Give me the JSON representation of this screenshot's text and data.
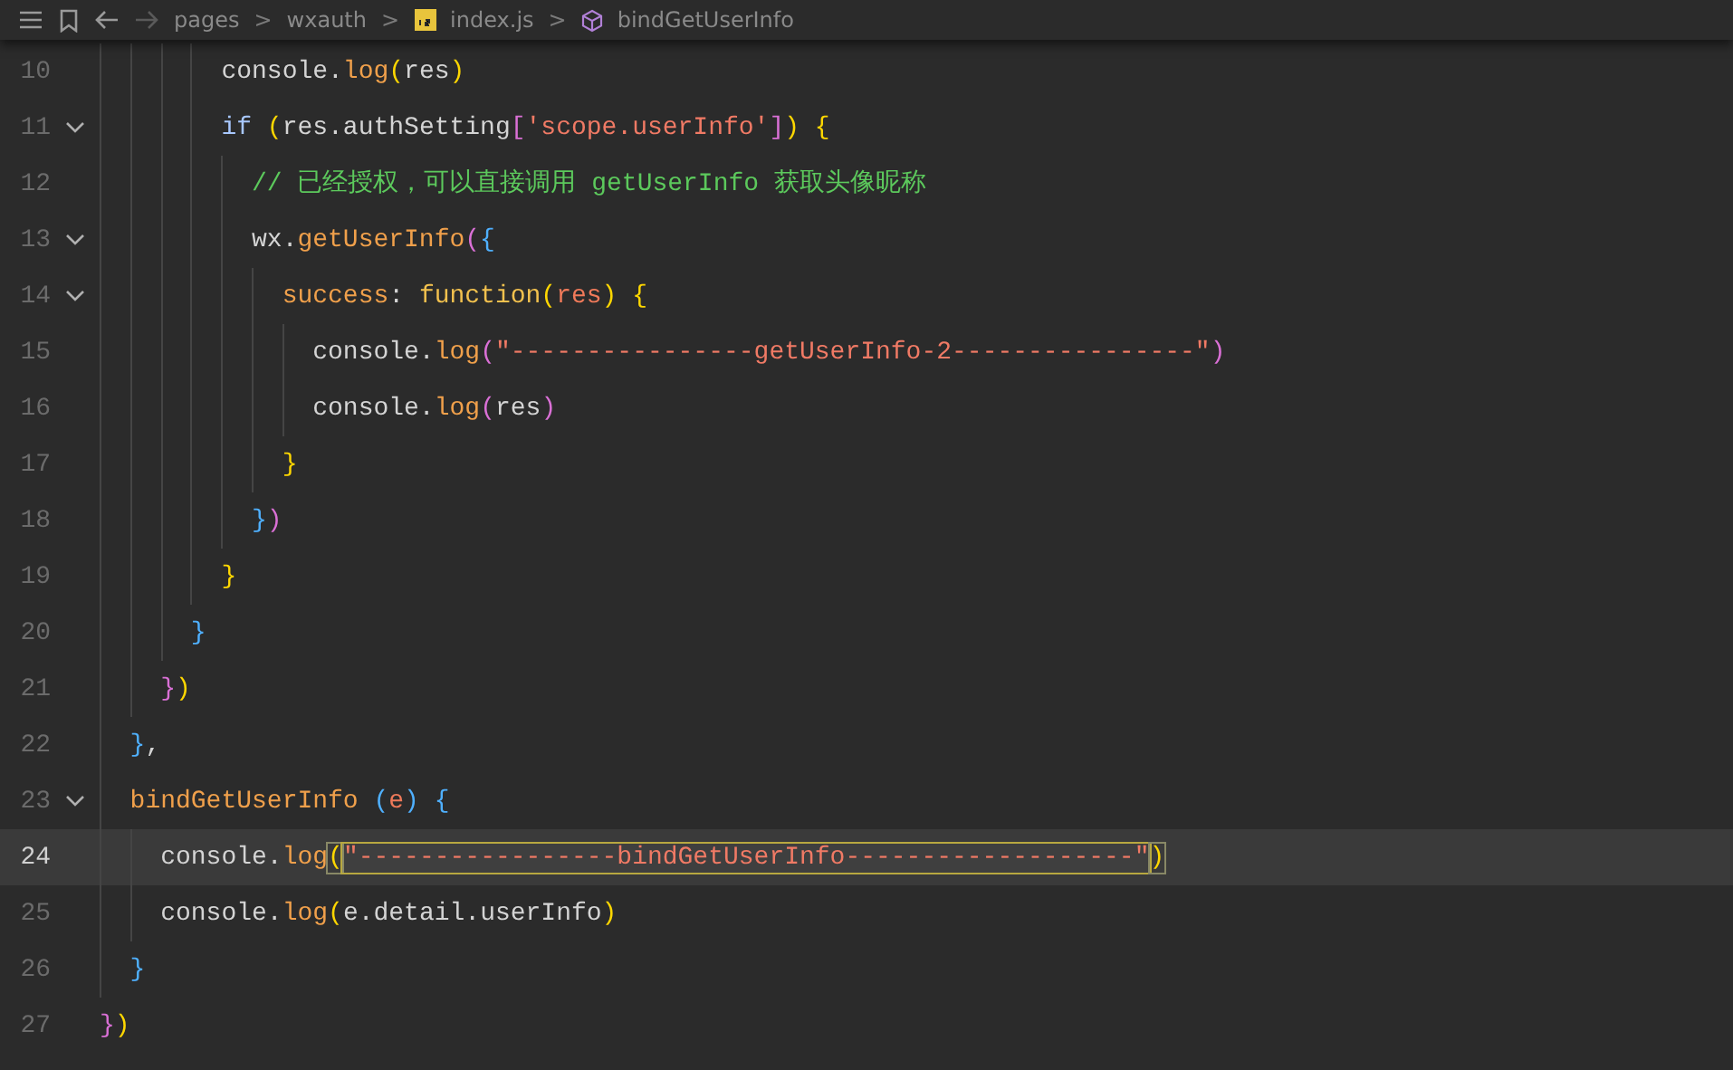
{
  "breadcrumb": {
    "items": [
      {
        "kind": "folder",
        "text": "pages"
      },
      {
        "kind": "folder",
        "text": "wxauth"
      },
      {
        "kind": "file",
        "text": "index.js"
      },
      {
        "kind": "symbol",
        "text": "bindGetUserInfo"
      }
    ],
    "separator": ">"
  },
  "lines": [
    {
      "number": "10",
      "foldable": false,
      "current": false,
      "tokens": [
        {
          "kind": "plain",
          "text": "        console."
        },
        {
          "kind": "method",
          "text": "log"
        },
        {
          "kind": "bracket-y",
          "text": "("
        },
        {
          "kind": "plain",
          "text": "res"
        },
        {
          "kind": "bracket-y",
          "text": ")"
        }
      ]
    },
    {
      "number": "11",
      "foldable": true,
      "current": false,
      "tokens": [
        {
          "kind": "control",
          "text": "        if "
        },
        {
          "kind": "bracket-y",
          "text": "("
        },
        {
          "kind": "plain",
          "text": "res.authSetting"
        },
        {
          "kind": "bracket-p",
          "text": "["
        },
        {
          "kind": "string",
          "text": "'scope.userInfo'"
        },
        {
          "kind": "bracket-p",
          "text": "]"
        },
        {
          "kind": "bracket-y",
          "text": ") {"
        }
      ]
    },
    {
      "number": "12",
      "foldable": false,
      "current": false,
      "tokens": [
        {
          "kind": "comment",
          "text": "          // 已经授权，可以直接调用 getUserInfo 获取头像昵称"
        }
      ]
    },
    {
      "number": "13",
      "foldable": true,
      "current": false,
      "tokens": [
        {
          "kind": "plain",
          "text": "          wx."
        },
        {
          "kind": "method",
          "text": "getUserInfo"
        },
        {
          "kind": "bracket-p",
          "text": "("
        },
        {
          "kind": "bracket-b",
          "text": "{"
        }
      ]
    },
    {
      "number": "14",
      "foldable": true,
      "current": false,
      "tokens": [
        {
          "kind": "property",
          "text": "            success"
        },
        {
          "kind": "plain",
          "text": ": "
        },
        {
          "kind": "keyword",
          "text": "function"
        },
        {
          "kind": "bracket-y",
          "text": "("
        },
        {
          "kind": "param",
          "text": "res"
        },
        {
          "kind": "bracket-y",
          "text": ") {"
        }
      ]
    },
    {
      "number": "15",
      "foldable": false,
      "current": false,
      "tokens": [
        {
          "kind": "plain",
          "text": "              console."
        },
        {
          "kind": "method",
          "text": "log"
        },
        {
          "kind": "bracket-p",
          "text": "("
        },
        {
          "kind": "string",
          "text": "\"----------------getUserInfo-2----------------\""
        },
        {
          "kind": "bracket-p",
          "text": ")"
        }
      ]
    },
    {
      "number": "16",
      "foldable": false,
      "current": false,
      "tokens": [
        {
          "kind": "plain",
          "text": "              console."
        },
        {
          "kind": "method",
          "text": "log"
        },
        {
          "kind": "bracket-p",
          "text": "("
        },
        {
          "kind": "plain",
          "text": "res"
        },
        {
          "kind": "bracket-p",
          "text": ")"
        }
      ]
    },
    {
      "number": "17",
      "foldable": false,
      "current": false,
      "tokens": [
        {
          "kind": "bracket-y",
          "text": "            }"
        }
      ]
    },
    {
      "number": "18",
      "foldable": false,
      "current": false,
      "tokens": [
        {
          "kind": "bracket-b",
          "text": "          }"
        },
        {
          "kind": "bracket-p",
          "text": ")"
        }
      ]
    },
    {
      "number": "19",
      "foldable": false,
      "current": false,
      "tokens": [
        {
          "kind": "bracket-y",
          "text": "        }"
        }
      ]
    },
    {
      "number": "20",
      "foldable": false,
      "current": false,
      "tokens": [
        {
          "kind": "bracket-b",
          "text": "      }"
        }
      ]
    },
    {
      "number": "21",
      "foldable": false,
      "current": false,
      "tokens": [
        {
          "kind": "bracket-p",
          "text": "    }"
        },
        {
          "kind": "bracket-y",
          "text": ")"
        }
      ]
    },
    {
      "number": "22",
      "foldable": false,
      "current": false,
      "tokens": [
        {
          "kind": "bracket-b",
          "text": "  }"
        },
        {
          "kind": "plain",
          "text": ","
        }
      ]
    },
    {
      "number": "23",
      "foldable": true,
      "current": false,
      "tokens": [
        {
          "kind": "method",
          "text": "  bindGetUserInfo "
        },
        {
          "kind": "bracket-b",
          "text": "("
        },
        {
          "kind": "param",
          "text": "e"
        },
        {
          "kind": "bracket-b",
          "text": ") {"
        }
      ]
    },
    {
      "number": "24",
      "foldable": false,
      "current": true,
      "tokens": [
        {
          "kind": "plain",
          "text": "    console."
        },
        {
          "kind": "method",
          "text": "log"
        },
        {
          "kind": "bracket-y",
          "text": "(",
          "matched": true
        },
        {
          "kind": "string",
          "text": "\"-----------------bindGetUserInfo-------------------\"",
          "selected": true
        },
        {
          "kind": "bracket-y",
          "text": ")",
          "matched": true
        }
      ]
    },
    {
      "number": "25",
      "foldable": false,
      "current": false,
      "tokens": [
        {
          "kind": "plain",
          "text": "    console."
        },
        {
          "kind": "method",
          "text": "log"
        },
        {
          "kind": "bracket-y",
          "text": "("
        },
        {
          "kind": "plain",
          "text": "e.detail.userInfo"
        },
        {
          "kind": "bracket-y",
          "text": ")"
        }
      ]
    },
    {
      "number": "26",
      "foldable": false,
      "current": false,
      "tokens": [
        {
          "kind": "bracket-b",
          "text": "  }"
        }
      ]
    },
    {
      "number": "27",
      "foldable": false,
      "current": false,
      "tokens": [
        {
          "kind": "bracket-p",
          "text": "}"
        },
        {
          "kind": "bracket-y",
          "text": ")"
        }
      ]
    }
  ]
}
